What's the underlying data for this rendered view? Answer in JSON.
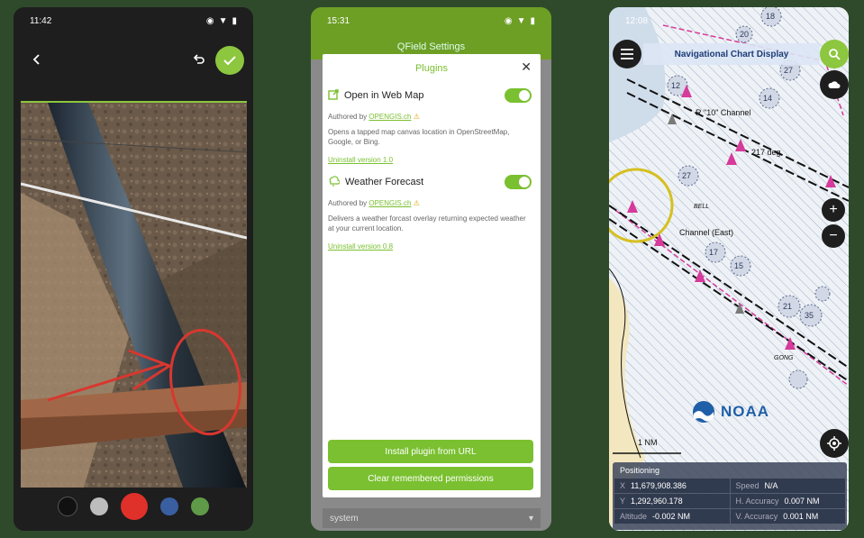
{
  "phone1": {
    "time": "11:42",
    "colors": [
      "#111111",
      "#bdbdbd",
      "#e0302a",
      "#3a5fa0",
      "#5f9a48"
    ]
  },
  "phone2": {
    "time": "15:31",
    "bg_title": "QField Settings",
    "dialog_title": "Plugins",
    "plugins": [
      {
        "name": "Open in Web Map",
        "authored_prefix": "Authored by ",
        "author": "OPENGIS.ch",
        "description": "Opens a tapped map canvas location in OpenStreetMap, Google, or Bing.",
        "uninstall": "Uninstall version 1.0"
      },
      {
        "name": "Weather Forecast",
        "authored_prefix": "Authored by ",
        "author": "OPENGIS.ch",
        "description": "Delivers a weather forcast overlay returning expected weather at your current location.",
        "uninstall": "Uninstall version 0.8"
      }
    ],
    "install_button": "Install plugin from URL",
    "clear_button": "Clear remembered permissions",
    "dropdown_value": "system"
  },
  "phone3": {
    "time": "12:08",
    "map_title": "Navigational Chart Display",
    "map_labels": {
      "channel1": "R \"10\" Channel",
      "deg": "217 deg",
      "channel2": "Channel (East)",
      "bell": "BELL",
      "gong": "GONG",
      "scale": "1 NM",
      "depths": [
        "12",
        "14",
        "27",
        "17",
        "15",
        "17",
        "21",
        "35",
        "18",
        "20",
        "27"
      ]
    },
    "logo_text": "NOAA",
    "positioning": {
      "title": "Positioning",
      "x_label": "X",
      "x_value": "11,679,908.386",
      "y_label": "Y",
      "y_value": "1,292,960.178",
      "alt_label": "Altitude",
      "alt_value": "-0.002 NM",
      "speed_label": "Speed",
      "speed_value": "N/A",
      "hacc_label": "H. Accuracy",
      "hacc_value": "0.007 NM",
      "vacc_label": "V. Accuracy",
      "vacc_value": "0.001 NM"
    }
  }
}
